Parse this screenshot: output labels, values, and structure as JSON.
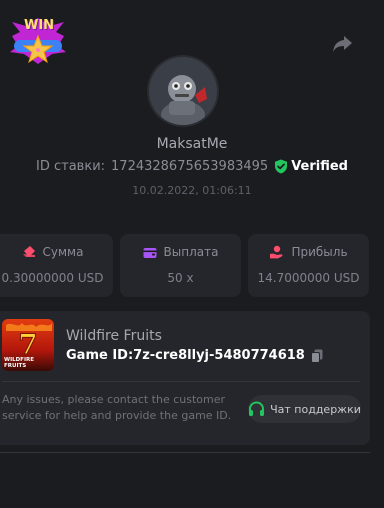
{
  "badge": {
    "text": "WIN"
  },
  "user": {
    "name": "MaksatMe"
  },
  "bet": {
    "label": "ID ставки:",
    "id": "1724328675653983495",
    "verified": "Verified",
    "date": "10.02.2022, 01:06:11"
  },
  "stats": [
    {
      "label": "Сумма",
      "value": "0.30000000 USD",
      "icon": "bet-ticket-icon",
      "color": "#ff4d6d"
    },
    {
      "label": "Выплата",
      "value": "50 x",
      "icon": "wallet-icon",
      "color": "#a855f7"
    },
    {
      "label": "Прибыль",
      "value": "14.7000000 USD",
      "icon": "profit-hand-icon",
      "color": "#ff4d6d"
    }
  ],
  "game": {
    "name": "Wildfire Fruits",
    "thumb_text": "WILDFIRE FRUITS",
    "id_label": "Game ID:",
    "id_value": "7z-cre8llyj-5480774618",
    "help_text": "Any issues, please contact the customer service for help and provide the game ID.",
    "support_label": "Чат поддержки"
  },
  "colors": {
    "background": "#1b1c20",
    "card": "#25262c",
    "verified_green": "#22c55e",
    "support_green": "#22c55e"
  }
}
